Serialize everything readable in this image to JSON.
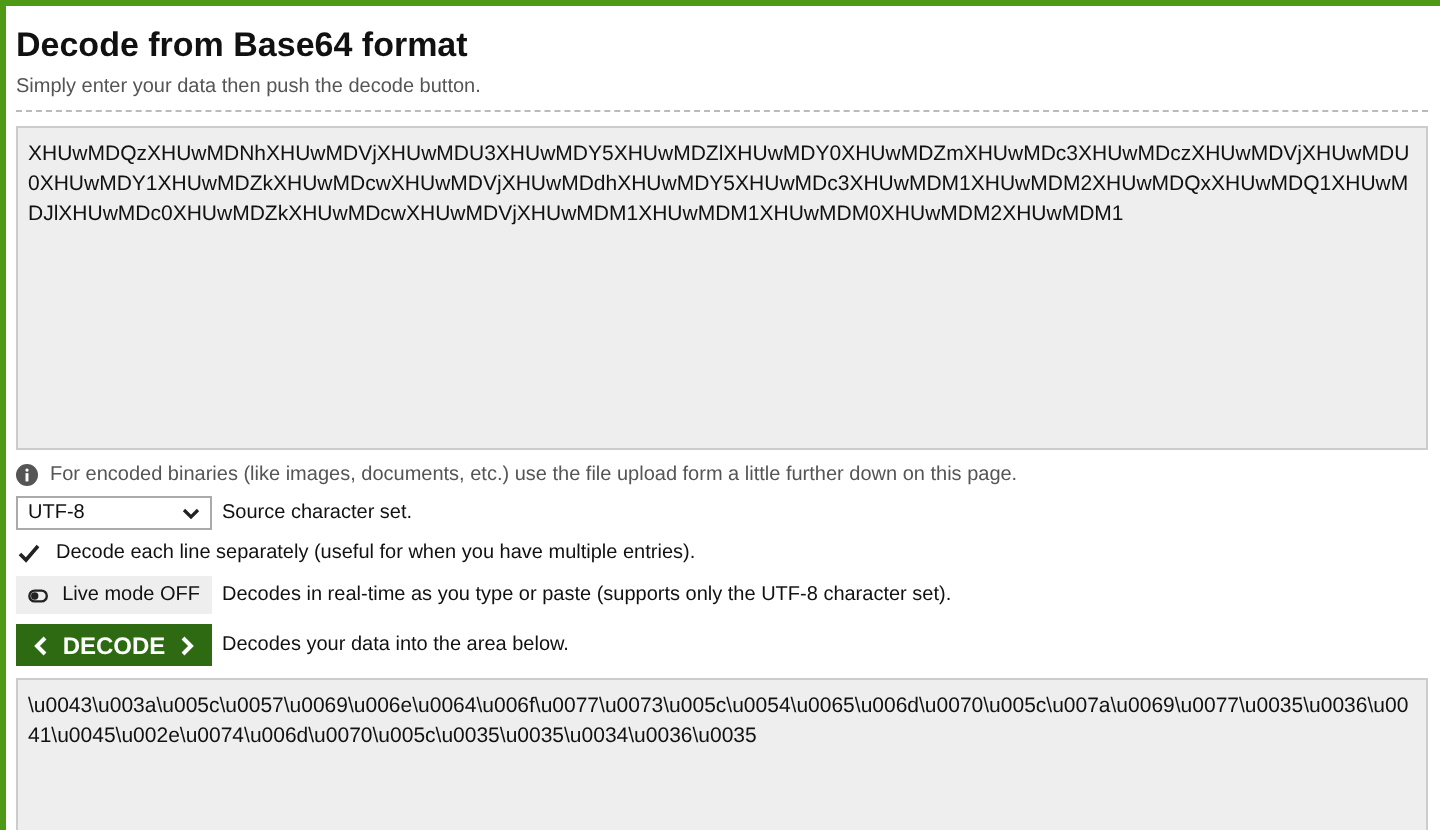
{
  "title": "Decode from Base64 format",
  "subtitle": "Simply enter your data then push the decode button.",
  "input": {
    "value": "XHUwMDQzXHUwMDNhXHUwMDVjXHUwMDU3XHUwMDY5XHUwMDZlXHUwMDY0XHUwMDZmXHUwMDc3XHUwMDczXHUwMDVjXHUwMDU0XHUwMDY1XHUwMDZkXHUwMDcwXHUwMDVjXHUwMDdhXHUwMDY5XHUwMDc3XHUwMDM1XHUwMDM2XHUwMDQxXHUwMDQ1XHUwMDJlXHUwMDc0XHUwMDZkXHUwMDcwXHUwMDVjXHUwMDM1XHUwMDM1XHUwMDM0XHUwMDM2XHUwMDM1"
  },
  "info": "For encoded binaries (like images, documents, etc.) use the file upload form a little further down on this page.",
  "charset": {
    "value": "UTF-8",
    "label": "Source character set."
  },
  "each_line": {
    "label": "Decode each line separately (useful for when you have multiple entries).",
    "checked": true
  },
  "live_mode": {
    "label": "Live mode OFF",
    "on": false,
    "description": "Decodes in real-time as you type or paste (supports only the UTF-8 character set)."
  },
  "decode": {
    "label": "DECODE",
    "description": "Decodes your data into the area below."
  },
  "output": {
    "value": "\\u0043\\u003a\\u005c\\u0057\\u0069\\u006e\\u0064\\u006f\\u0077\\u0073\\u005c\\u0054\\u0065\\u006d\\u0070\\u005c\\u007a\\u0069\\u0077\\u0035\\u0036\\u0041\\u0045\\u002e\\u0074\\u006d\\u0070\\u005c\\u0035\\u0035\\u0034\\u0036\\u0035"
  }
}
